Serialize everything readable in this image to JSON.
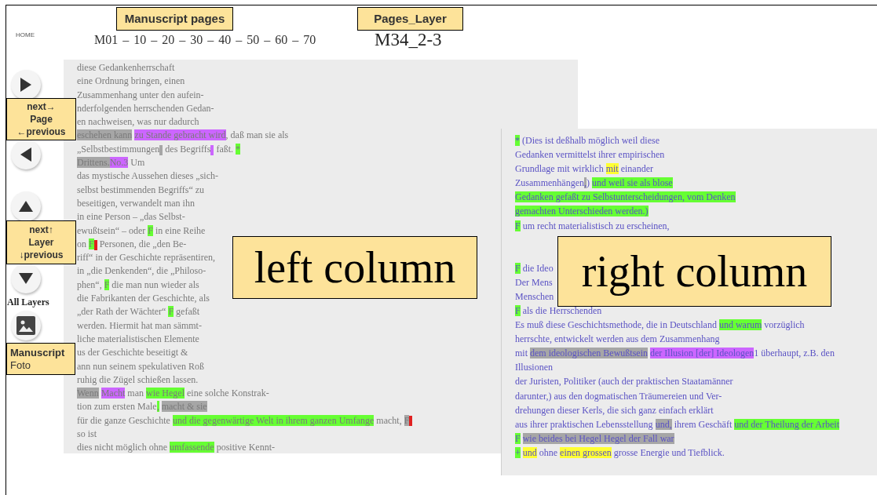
{
  "sidebar": {
    "home": "HOME",
    "buttons": [
      {
        "kind": "next"
      },
      {
        "kind": "previous"
      },
      {
        "kind": "up"
      },
      {
        "kind": "down"
      }
    ],
    "all_layers": "All Layers",
    "photo_button": {
      "kind": "image"
    }
  },
  "header": {
    "page_links": [
      "M01",
      "10",
      "20",
      "30",
      "40",
      "50",
      "60",
      "70"
    ],
    "separator": "–",
    "layer_id": "M34_2-3"
  },
  "left_column": {
    "lines": [
      [
        {
          "kind": "text",
          "text": "diese Gedankenherrschaft"
        }
      ],
      [
        {
          "kind": "text",
          "text": "eine Ordnung bringen, einen"
        }
      ],
      [
        {
          "kind": "text",
          "text": "Zusammenhang unter den aufein-"
        }
      ],
      [
        {
          "kind": "text",
          "text": "nderfolgenden herrschenden Gedan-"
        }
      ],
      [
        {
          "kind": "text",
          "text": "en nachweisen, was nur dadurch"
        }
      ],
      [
        {
          "kind": "text",
          "text": "eschehen kann",
          "color": "#a6a6a6"
        },
        {
          "kind": "space"
        },
        {
          "kind": "text",
          "text": "zu Stande gebracht wird",
          "color": "#cc66ff"
        },
        {
          "kind": "text",
          "text": ", daß man sie als"
        }
      ],
      [
        {
          "kind": "text",
          "text": "„Selbstbestimmungen"
        },
        {
          "kind": "marker",
          "color": "#a6a6a6"
        },
        {
          "kind": "text",
          "text": " des Begriffs"
        },
        {
          "kind": "marker",
          "color": "#cc66ff"
        },
        {
          "kind": "text",
          "text": " faßt. "
        },
        {
          "kind": "text",
          "text": "*",
          "color": "#66ff33"
        }
      ],
      [
        {
          "kind": "text",
          "text": "Drittens.",
          "color": "#a6a6a6"
        },
        {
          "kind": "text",
          "text": "No.3",
          "color": "#cc66ff"
        },
        {
          "kind": "text",
          "text": " Um"
        }
      ],
      [
        {
          "kind": "text",
          "text": "das mystische Aussehen dieses „sich-"
        }
      ],
      [
        {
          "kind": "text",
          "text": "selbst bestimmenden Begriffs“ zu"
        }
      ],
      [
        {
          "kind": "text",
          "text": "beseitigen, verwandelt man ihn"
        }
      ],
      [
        {
          "kind": "text",
          "text": "in eine Person – „das Selbst-"
        }
      ],
      [
        {
          "kind": "text",
          "text": "ewußtsein“ – oder "
        },
        {
          "kind": "text",
          "text": "F",
          "color": "#66ff33"
        },
        {
          "kind": "text",
          "text": " in eine Reihe"
        }
      ],
      [
        {
          "kind": "text",
          "text": "on "
        },
        {
          "kind": "text",
          "text": "F",
          "color": "#66ff33"
        },
        {
          "kind": "marker",
          "color": "#e02020"
        },
        {
          "kind": "text",
          "text": " Personen, die „den Be-"
        }
      ],
      [
        {
          "kind": "text",
          "text": "riff“ in der Geschichte repräsentiren,"
        }
      ],
      [
        {
          "kind": "text",
          "text": "in „die Denkenden“, die „Philoso-"
        }
      ],
      [
        {
          "kind": "text",
          "text": "phen“, "
        },
        {
          "kind": "text",
          "text": "F",
          "color": "#66ff33"
        },
        {
          "kind": "text",
          "text": " die man nun wieder als"
        }
      ],
      [
        {
          "kind": "text",
          "text": "die Fabrikanten der Geschichte, als"
        }
      ],
      [
        {
          "kind": "text",
          "text": "„der Rath der Wächter“ "
        },
        {
          "kind": "text",
          "text": "F",
          "color": "#66ff33"
        },
        {
          "kind": "text",
          "text": " gefaßt"
        }
      ],
      [
        {
          "kind": "text",
          "text": "werden. Hiermit hat man sämmt-"
        }
      ],
      [
        {
          "kind": "text",
          "text": "liche materialistischen Elemente"
        }
      ],
      [
        {
          "kind": "text",
          "text": "us der Geschichte beseitigt &"
        }
      ],
      [
        {
          "kind": "text",
          "text": "ann nun seinem spekulativen Roß"
        }
      ],
      [
        {
          "kind": "text",
          "text": "ruhig die Zügel schießen lassen."
        }
      ],
      [
        {
          "kind": "text",
          "text": "Wenn",
          "color": "#a6a6a6"
        },
        {
          "kind": "space"
        },
        {
          "kind": "text",
          "text": "Macht",
          "color": "#cc66ff"
        },
        {
          "kind": "text",
          "text": " man "
        },
        {
          "kind": "text",
          "text": "wie Hegel",
          "color": "#66ff33"
        },
        {
          "kind": "text",
          "text": " eine solche Konstrak-"
        }
      ],
      [
        {
          "kind": "text",
          "text": "tion zum ersten Male"
        },
        {
          "kind": "text",
          "text": ",",
          "color": "#66ff33"
        },
        {
          "kind": "space"
        },
        {
          "kind": "text",
          "text": "macht & sie",
          "color": "#a6a6a6"
        }
      ],
      [
        {
          "kind": "text",
          "text": "für die ganze Geschichte "
        },
        {
          "kind": "text",
          "text": "und die gegenwärtige Welt in ihrem ganzen Umfange",
          "color": "#66ff33"
        },
        {
          "kind": "text",
          "text": " macht, "
        },
        {
          "kind": "text",
          "text": "F",
          "color": "#a6a6a6"
        },
        {
          "kind": "marker",
          "color": "#e02020"
        }
      ],
      [
        {
          "kind": "text",
          "text": "so ist"
        }
      ],
      [
        {
          "kind": "text",
          "text": "dies nicht möglich ohne "
        },
        {
          "kind": "text",
          "text": "umfassende",
          "color": "#66ff33"
        },
        {
          "kind": "text",
          "text": " positive Kennt-"
        }
      ]
    ]
  },
  "right_column": {
    "blocks": [
      [
        [
          {
            "kind": "text",
            "text": "*",
            "color": "#66ff33"
          },
          {
            "kind": "text",
            "text": " (Dies ist deßhalb möglich weil diese"
          }
        ],
        [
          {
            "kind": "text",
            "text": "Gedanken vermittelst ihrer empirischen"
          }
        ],
        [
          {
            "kind": "text",
            "text": "Grundlage mit wirklich "
          },
          {
            "kind": "text",
            "text": "mit",
            "color": "#ffff33"
          },
          {
            "kind": "text",
            "text": " einander"
          }
        ],
        [
          {
            "kind": "text",
            "text": "Zusammenhängen"
          },
          {
            "kind": "text",
            "text": ",",
            "color": "#a6a6a6"
          },
          {
            "kind": "text",
            "text": ") "
          },
          {
            "kind": "text",
            "text": "und weil sie als blose",
            "color": "#66ff33"
          }
        ],
        [
          {
            "kind": "text",
            "text": "Gedanken gefaßt zu Selbstunterscheidungen, vom Denken",
            "color": "#66ff33"
          }
        ],
        [
          {
            "kind": "text",
            "text": "gemachten Unterschieden werden.)",
            "color": "#66ff33"
          }
        ],
        [
          {
            "kind": "text",
            "text": "F",
            "color": "#66ff33"
          },
          {
            "kind": "text",
            "text": " um recht materialistisch zu erscheinen,"
          }
        ]
      ],
      [
        [
          {
            "kind": "text",
            "text": "F",
            "color": "#66ff33"
          },
          {
            "kind": "text",
            "text": " die Ideo"
          }
        ],
        [
          {
            "kind": "text",
            "text": "Der Mens"
          }
        ],
        [
          {
            "kind": "text",
            "text": "Menschen"
          }
        ],
        [
          {
            "kind": "text",
            "text": "F",
            "color": "#66ff33"
          },
          {
            "kind": "text",
            "text": " als die Herrschenden"
          }
        ],
        [
          {
            "kind": "text",
            "text": "Es muß diese Geschichtsmethode, die in Deutschland "
          },
          {
            "kind": "text",
            "text": "und warum",
            "color": "#66ff33"
          },
          {
            "kind": "text",
            "text": " vorzüglich"
          }
        ],
        [
          {
            "kind": "text",
            "text": "herrschte, entwickelt werden aus dem Zusammenhang"
          }
        ],
        [
          {
            "kind": "text",
            "text": "mit "
          },
          {
            "kind": "text",
            "text": "dem ideologischen Bewußtsein",
            "color": "#a6a6a6"
          },
          {
            "kind": "space"
          },
          {
            "kind": "text",
            "text": "der Illusion [der] Ideologen",
            "color": "#cc66ff"
          },
          {
            "kind": "text",
            "text": "1 überhaupt, z.B. den"
          }
        ],
        [
          {
            "kind": "text",
            "text": "Illusionen"
          }
        ],
        [
          {
            "kind": "text",
            "text": "der Juristen, Politiker (auch der praktischen Staatamänner"
          }
        ],
        [
          {
            "kind": "text",
            "text": "darunter,) aus den dogmatischen Träumereien und Ver-"
          }
        ],
        [
          {
            "kind": "text",
            "text": "drehungen dieser Kerls, die sich ganz einfach erklärt"
          }
        ],
        [
          {
            "kind": "text",
            "text": "aus ihrer praktischen Lebensstellung "
          },
          {
            "kind": "text",
            "text": "und,",
            "color": "#a6a6a6"
          },
          {
            "kind": "text",
            "text": " ihrem Geschäft "
          },
          {
            "kind": "text",
            "text": "und der Theilung der Arbeit",
            "color": "#66ff33"
          }
        ],
        [
          {
            "kind": "text",
            "text": "F",
            "color": "#66ff33"
          },
          {
            "kind": "space"
          },
          {
            "kind": "text",
            "text": "wie beides bei Hegel Hegel der Fall war",
            "color": "#a6a6a6"
          }
        ],
        [
          {
            "kind": "text",
            "text": "+",
            "color": "#66ff33"
          },
          {
            "kind": "space"
          },
          {
            "kind": "text",
            "text": "und",
            "color": "#ffff33"
          },
          {
            "kind": "text",
            "text": " ohne "
          },
          {
            "kind": "text",
            "text": "einen grossen",
            "color": "#ffff33"
          },
          {
            "kind": "text",
            "text": " grosse Energie und Tiefblick."
          }
        ]
      ]
    ]
  },
  "annotations": {
    "manuscript_pages": "Manuscript pages",
    "pages_layer": "Pages_Layer",
    "left_column": "left column",
    "right_column": "right column",
    "page_nav": {
      "lines": [
        "next→",
        "Page",
        "←previous"
      ],
      "centered": true
    },
    "layer_nav": {
      "lines": [
        "next↑",
        "Layer",
        "↓previous"
      ],
      "centered": true
    },
    "foto": {
      "lines": [
        "**Manuscript**",
        "Foto"
      ],
      "centered": false
    }
  }
}
